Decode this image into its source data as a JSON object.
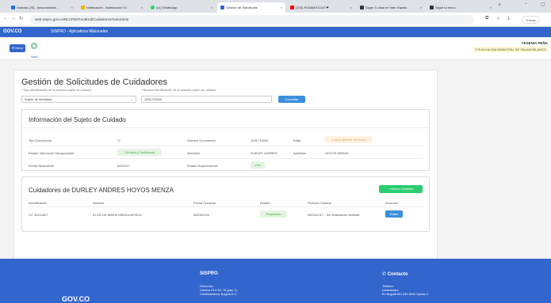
{
  "browser": {
    "tabs": [
      {
        "label": "Noticias (25) - desconéctate -",
        "color": "#1a73e8"
      },
      {
        "label": "Notificación - Notificación Co",
        "color": "#f4b400"
      },
      {
        "label": "(11) WhatsApp",
        "color": "#25d366"
      },
      {
        "label": "Gestión de Solicitudes",
        "color": "#3366cc"
      },
      {
        "label": "(153) ROMANTICAS ❤",
        "color": "#ff0000"
      },
      {
        "label": "Sigue Tu lista en Inter Rapido",
        "color": "#333333"
      },
      {
        "label": "Sigue tu envío",
        "color": "#333333"
      }
    ],
    "url": "web.sispro.gov.co/RLCPD/FrontEnd/Cuidadores/Solicitante",
    "profile_label": "Trabajo"
  },
  "govbar": {
    "logo": "GOV.CO",
    "title": "SISPRO - Aplicativos Misionales"
  },
  "header": {
    "menu_label": "Menú",
    "logo_text": "Salud",
    "user_name": "YESENIA PEÑA",
    "entity": "275 ALCALDIA MUNICIPAL DE SALADOBLANCO"
  },
  "page": {
    "title": "Gestión de Solicitudes de Cuidadores",
    "tipo_id_label": "* Tipo Identificación de la persona sujeto de cuidado",
    "tipo_id_value": "Sujeto de Identidad",
    "num_id_label": "* Número Identificación de la persona sujeto de cuidado",
    "num_id_value": "1091733940",
    "consultar_label": "Consultar"
  },
  "subject": {
    "title": "Información del Sujeto de Cuidado",
    "rows": [
      [
        {
          "k": "Tipo Documento",
          "v": "TI"
        },
        {
          "k": "Número Documento",
          "v": "1091733940"
        },
        {
          "k": "Edad",
          "v": "6 años (Menor de edad)"
        }
      ],
      [
        {
          "k": "Estado Valoración Discapacidad",
          "v": "Cerrada y Certificada"
        },
        {
          "k": "Nombres",
          "v": "DURLEY ANDRES"
        },
        {
          "k": "Apellidos",
          "v": "HOYOS MENZA"
        }
      ],
      [
        {
          "k": "Fecha Nacimiento",
          "v": "6/4/2017"
        },
        {
          "k": "Estado Supervivencia",
          "v": "Vivo"
        }
      ]
    ]
  },
  "cuidadores": {
    "title": "Cuidadores de DURLEY ANDRES HOYOS MENZA",
    "new_button": "+ Nuevo Cuidador",
    "headers": [
      "Identificación",
      "Nombre",
      "Fecha Creación",
      "Estado",
      "Periodo Cuidado",
      "Acciones"
    ],
    "rows": [
      {
        "id": "CC 34110607",
        "nombre": "ELOR DE MARIA MENZA MOSCA",
        "fecha": "06/05/2020",
        "estado": "Registrado",
        "periodo": "06/04/2017 - Sin finalización definida",
        "accion": "Editar"
      }
    ]
  },
  "footer": {
    "logo": "GOV.CO",
    "sispro_title": "SISPRO",
    "dir_label": "Dirección:",
    "dir1": "Carrera 13 # 32- 76 (piso 1)",
    "dir2": "Cundinamarca, Bogotá D.C.",
    "contact_title": "Contacto",
    "tel_label": "Teléfono",
    "conm_label": "conmutador:",
    "tel_value": "En Bogotá 601 330 5043 Opción 2"
  }
}
